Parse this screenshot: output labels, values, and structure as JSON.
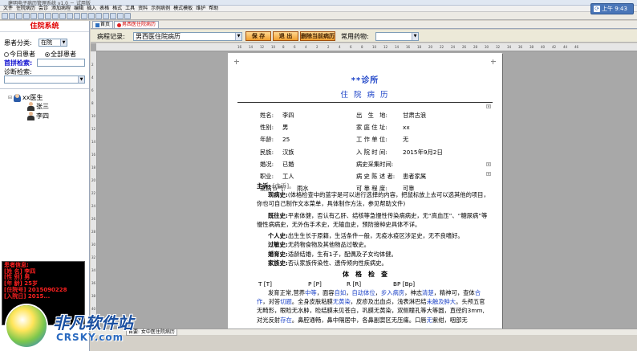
{
  "window": {
    "title": "建明电子病历管理系统 v1.0 － 试用版"
  },
  "menu": [
    "文件",
    "住院病历",
    "会诊",
    "添加病程",
    "编辑",
    "插入",
    "表格",
    "格式",
    "工具",
    "资料",
    "示例病例",
    "模式模板",
    "维护",
    "帮助"
  ],
  "topright": {
    "label": "上午 9:43"
  },
  "left": {
    "title": "住院系统",
    "category_label": "患者分类:",
    "category_value": "在院",
    "radio_today": "今日患者",
    "radio_all": "全部患者",
    "search_label": "首拼检索:",
    "diag_label": "诊断检索:",
    "tree": {
      "doctor": "xx医生",
      "patients": [
        "张三",
        "李四"
      ]
    },
    "info": {
      "heading": "患者信息:",
      "lines": [
        "[姓  名] 李四",
        "[性  别] 男",
        "[年  龄] 25岁",
        "[住院号] 2015090228",
        "[入院日] 2015..."
      ]
    }
  },
  "tabs": [
    {
      "label": "首页"
    },
    {
      "label": "男西医住院病历"
    }
  ],
  "recordbar": {
    "record_label": "病程记录:",
    "record_value": "男西医住院病历",
    "save": "保 存",
    "exit": "退 出",
    "del": "删除当前病历",
    "common_label": "常用药物:"
  },
  "ruler": {
    "h": [
      "16",
      "14",
      "12",
      "10",
      "8",
      "6",
      "4",
      "2",
      "2",
      "4",
      "6",
      "8",
      "10",
      "12",
      "14",
      "16",
      "18",
      "20",
      "22",
      "24",
      "26",
      "28",
      "30",
      "32",
      "34",
      "36",
      "38",
      "40",
      "42",
      "44",
      "46"
    ],
    "v": [
      "2",
      "4",
      "6",
      "8",
      "10",
      "12",
      "14",
      "16",
      "18",
      "20",
      "22",
      "24",
      "26",
      "28",
      "30",
      "32",
      "34",
      "36",
      "38",
      "40",
      "42"
    ]
  },
  "doc": {
    "clinic": "**诊所",
    "title": "住 院 病 历",
    "rows": [
      [
        {
          "k": "姓名:",
          "v": "李四"
        },
        {
          "k": "出　生　地:",
          "v": "甘肃古浪"
        }
      ],
      [
        {
          "k": "性别:",
          "v": "男"
        },
        {
          "k": "家 庭 住 址:",
          "v": "xx"
        }
      ],
      [
        {
          "k": "年龄:",
          "v": "25"
        },
        {
          "k": "工 作 单 位:",
          "v": "无"
        }
      ],
      [
        {
          "k": "民族:",
          "v": "汉族"
        },
        {
          "k": "入 院 时 间:",
          "v": "2015年9月2日"
        }
      ],
      [
        {
          "k": "婚况:",
          "v": "已婚"
        },
        {
          "k": "病史采集时间:",
          "v": ""
        }
      ],
      [
        {
          "k": "职业:",
          "v": "工人"
        },
        {
          "k": "病 史 陈 述 者:",
          "v": "患者家属"
        }
      ],
      [
        {
          "k": "发病节气:",
          "v": "雨水"
        },
        {
          "k": "可 靠 程 度:",
          "v": "可靠"
        }
      ]
    ],
    "chief_label": "主诉:",
    "chief_value": "[主诉]。",
    "present_label": "现病史:",
    "present_text": "(体格检查中的蓝字是可以进行选择的内容，把鼠标放上去可以选其他的项目，你也可自己制作文本菜单，具体制作方法，参见帮助文件)",
    "past_label": "既往史:",
    "past_text": "平素体健，否认有乙肝、结核等急慢性传染病病史，无“高血压”、“糖尿病”等慢性病病史，无外伤手术史，无输血史，预防接种史具体不详。",
    "personal_label": "个人史:",
    "personal_text": "出生生长于原籍，生活条件一般，无疫水疫区涉足史，无不良嗜好。",
    "allergy_label": "过敏史:",
    "allergy_text": "无药物食物及其他物品过敏史。",
    "marital_label": "婚育史:",
    "marital_text": "适龄结婚，生有1子，配偶及子女均体健。",
    "family_label": "家族史:",
    "family_text": "否认家族传染性、遗传倾向性疾病史。",
    "exam_title": "体　格　检　查",
    "vitals": [
      "T [T]",
      "P [P]",
      "R [R]",
      "BP [Bp]"
    ],
    "exam_p1": "发育正常,营养",
    "exam_w1": "中等",
    "exam_p2": "，面容",
    "exam_w2": "自如",
    "exam_p3": "，",
    "exam_w3": "自动体位",
    "exam_p4": "，",
    "exam_w4": "步入病房",
    "exam_p5": "，神志",
    "exam_w5": "清楚",
    "exam_p6": "，精神可，查体",
    "exam_w6": "合作",
    "exam_p7": "，对答",
    "exam_w7": "切题",
    "exam_p8": "。全身皮肤粘膜",
    "exam_w8": "无黄染",
    "exam_p9": "，皮疹及出血点，浅表淋巴结",
    "exam_w9": "未触及肿大",
    "exam_p10": "。头颅五官无畸形，眼睑无水肿，睑结膜未见苍白，巩膜无黄染，双侧瞳孔等大等圆，直径约3mm,对光反射",
    "exam_w10": "存在",
    "exam_p11": "。鼻腔通畅，鼻中隔居中，各鼻副窦区无压痛。口唇",
    "exam_w11": "无",
    "exam_p12": "紫绀，咽部无"
  },
  "status": {
    "tab": "首要: 女中医住院病历"
  },
  "watermark": {
    "t1": "非凡软件站",
    "t2": "CRSKY.com"
  }
}
